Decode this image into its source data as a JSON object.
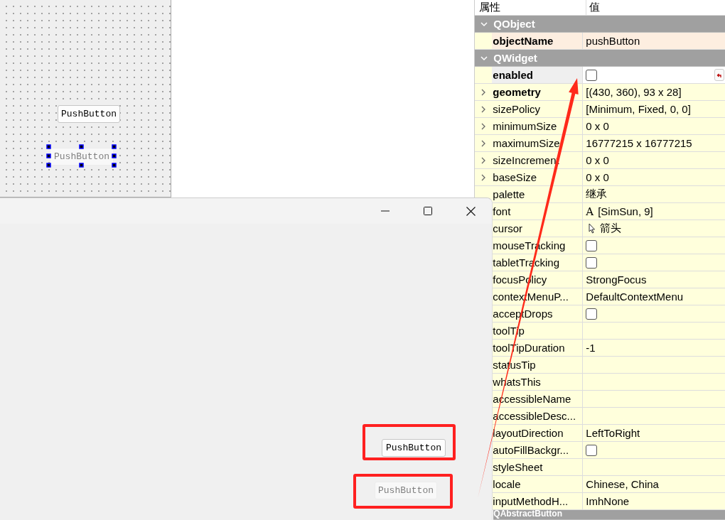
{
  "designer_form": {
    "buttons": [
      {
        "label": "PushButton",
        "disabled": false,
        "selected": false
      },
      {
        "label": "PushButton",
        "disabled": true,
        "selected": true
      }
    ]
  },
  "property_editor": {
    "columns": [
      "属性",
      "值"
    ],
    "groups": [
      {
        "name": "QObject",
        "expanded": true,
        "color": "#fdeee0",
        "properties": [
          {
            "name": "objectName",
            "kind": "text",
            "value": "pushButton",
            "modified": true,
            "expandable": false
          }
        ]
      },
      {
        "name": "QWidget",
        "expanded": true,
        "color": "#ffffdc",
        "properties": [
          {
            "name": "enabled",
            "kind": "checkbox",
            "checked": false,
            "modified": true,
            "expandable": false,
            "editing": true
          },
          {
            "name": "geometry",
            "kind": "text",
            "value": "[(430, 360), 93 x 28]",
            "modified": true,
            "expandable": true
          },
          {
            "name": "sizePolicy",
            "kind": "text",
            "value": "[Minimum, Fixed, 0, 0]",
            "modified": false,
            "expandable": true
          },
          {
            "name": "minimumSize",
            "kind": "text",
            "value": "0 x 0",
            "modified": false,
            "expandable": true
          },
          {
            "name": "maximumSize",
            "kind": "text",
            "value": "16777215 x 16777215",
            "modified": false,
            "expandable": true
          },
          {
            "name": "sizeIncrement",
            "kind": "text",
            "value": "0 x 0",
            "modified": false,
            "expandable": true
          },
          {
            "name": "baseSize",
            "kind": "text",
            "value": "0 x 0",
            "modified": false,
            "expandable": true
          },
          {
            "name": "palette",
            "kind": "text",
            "value": "继承",
            "modified": false,
            "expandable": false
          },
          {
            "name": "font",
            "kind": "font",
            "glyph": "A",
            "value": "[SimSun, 9]",
            "modified": false,
            "expandable": false
          },
          {
            "name": "cursor",
            "kind": "cursor",
            "value": "箭头",
            "modified": false,
            "expandable": false
          },
          {
            "name": "mouseTracking",
            "kind": "checkbox",
            "checked": false,
            "modified": false,
            "expandable": false
          },
          {
            "name": "tabletTracking",
            "kind": "checkbox",
            "checked": false,
            "modified": false,
            "expandable": false
          },
          {
            "name": "focusPolicy",
            "kind": "text",
            "value": "StrongFocus",
            "modified": false,
            "expandable": false
          },
          {
            "name": "contextMenuP...",
            "kind": "text",
            "value": "DefaultContextMenu",
            "modified": false,
            "expandable": false
          },
          {
            "name": "acceptDrops",
            "kind": "checkbox",
            "checked": false,
            "modified": false,
            "expandable": false
          },
          {
            "name": "toolTip",
            "kind": "empty",
            "modified": false,
            "expandable": false
          },
          {
            "name": "toolTipDuration",
            "kind": "text",
            "value": "-1",
            "modified": false,
            "expandable": false
          },
          {
            "name": "statusTip",
            "kind": "empty",
            "modified": false,
            "expandable": false
          },
          {
            "name": "whatsThis",
            "kind": "empty",
            "modified": false,
            "expandable": false
          },
          {
            "name": "accessibleName",
            "kind": "empty",
            "modified": false,
            "expandable": false
          },
          {
            "name": "accessibleDesc...",
            "kind": "empty",
            "modified": false,
            "expandable": false
          },
          {
            "name": "layoutDirection",
            "kind": "text",
            "value": "LeftToRight",
            "modified": false,
            "expandable": false
          },
          {
            "name": "autoFillBackgr...",
            "kind": "checkbox",
            "checked": false,
            "modified": false,
            "expandable": false
          },
          {
            "name": "styleSheet",
            "kind": "empty",
            "modified": false,
            "expandable": false
          },
          {
            "name": "locale",
            "kind": "text",
            "value": "Chinese, China",
            "modified": false,
            "expandable": false
          },
          {
            "name": "inputMethodH...",
            "kind": "text",
            "value": "ImhNone",
            "modified": false,
            "expandable": false
          }
        ]
      },
      {
        "name": "QAbstractButton"
      }
    ]
  },
  "preview_window": {
    "buttons": [
      {
        "label": "PushButton",
        "disabled": false
      },
      {
        "label": "PushButton",
        "disabled": true
      }
    ]
  }
}
